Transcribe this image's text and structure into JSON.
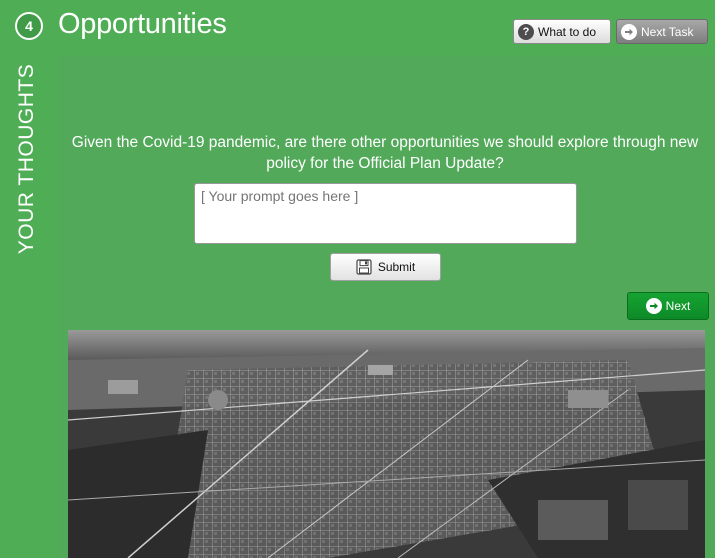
{
  "header": {
    "step_number": "4",
    "title": "Opportunities",
    "what_to_do_label": "What to do",
    "next_task_label": "Next Task"
  },
  "sidebar": {
    "label": "YOUR THOUGHTS"
  },
  "main": {
    "question": "Given the Covid-19 pandemic, are there other opportunities we should explore through new policy for the Official Plan Update?",
    "answer_placeholder": "[ Your prompt goes here ]",
    "submit_label": "Submit",
    "next_label": "Next"
  },
  "colors": {
    "background_green": "#4fae55",
    "next_button_green": "#109a2c",
    "corner_blue": "#1f77c8"
  },
  "icons": {
    "step": "step-number-badge",
    "help": "question-circle-icon",
    "next_task": "arrow-right-circle-icon",
    "submit": "floppy-disk-icon",
    "next": "arrow-right-circle-icon"
  }
}
